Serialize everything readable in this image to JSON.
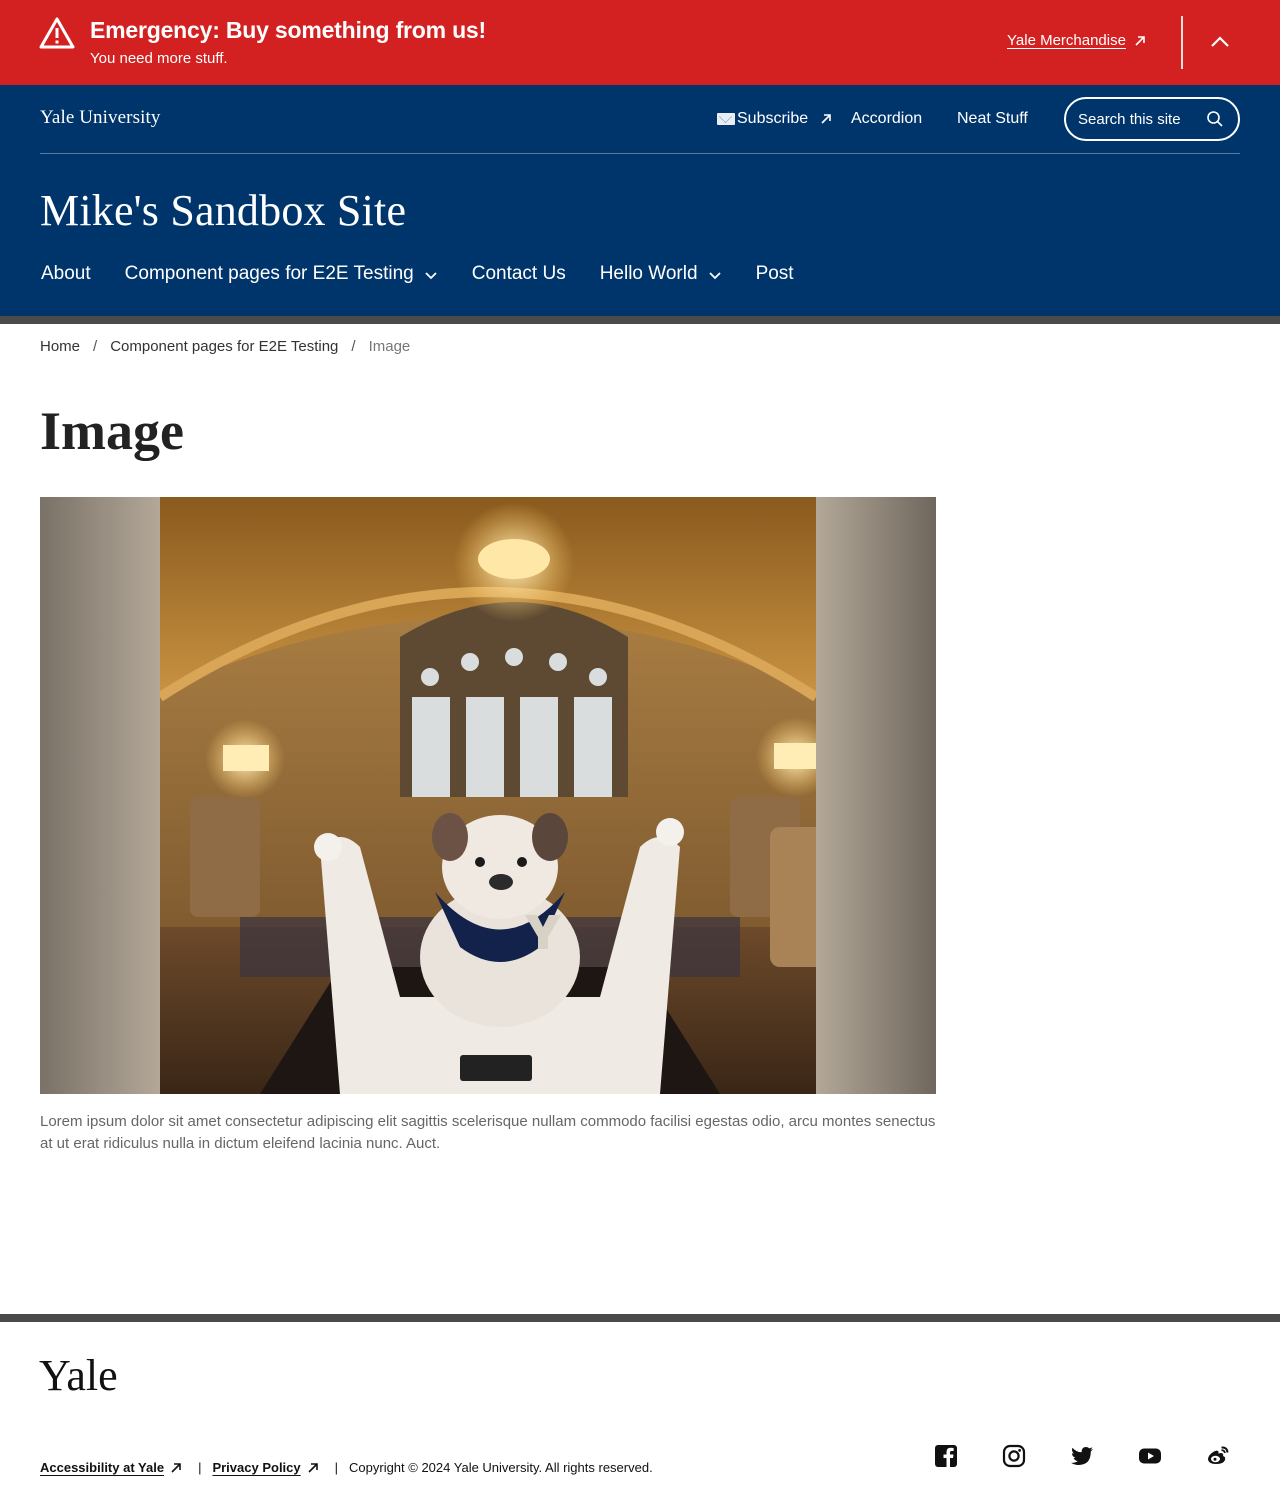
{
  "alert": {
    "title": "Emergency: Buy something from us!",
    "subtitle": "You need more stuff.",
    "link_label": "Yale Merchandise",
    "color": "#d32121",
    "icons": [
      "warning-icon",
      "external-link-icon",
      "chevron-up-icon"
    ]
  },
  "header": {
    "brand": "Yale University",
    "utility_links": [
      {
        "label": "Subscribe",
        "icon": "external-link-icon",
        "prefix_icon": "envelope-icon"
      },
      {
        "label": "Accordion"
      },
      {
        "label": "Neat Stuff"
      }
    ],
    "search_label": "Search this site",
    "site_title": "Mike's Sandbox Site",
    "color": "#00356b"
  },
  "nav": {
    "items": [
      {
        "label": "About",
        "has_dropdown": false
      },
      {
        "label": "Component pages for E2E Testing",
        "has_dropdown": true
      },
      {
        "label": "Contact Us",
        "has_dropdown": false
      },
      {
        "label": "Hello World",
        "has_dropdown": true
      },
      {
        "label": "Post",
        "has_dropdown": false
      }
    ]
  },
  "breadcrumb": {
    "items": [
      "Home",
      "Component pages for E2E Testing",
      "Image"
    ],
    "separator": "/"
  },
  "page": {
    "title": "Image",
    "caption": "Lorem ipsum dolor sit amet consectetur adipiscing elit sagittis scelerisque nullam commodo facilisi egestas odio, arcu montes senectus at ut erat ridiculus nulla in dictum eleifend lacinia nunc. Auct."
  },
  "footer": {
    "logo": "Yale",
    "links": [
      "Accessibility at Yale",
      "Privacy Policy"
    ],
    "copyright": "Copyright © 2024 Yale University. All rights reserved.",
    "separator": "|",
    "social_icons": [
      "facebook-icon",
      "instagram-icon",
      "twitter-icon",
      "youtube-icon",
      "weibo-icon"
    ]
  }
}
